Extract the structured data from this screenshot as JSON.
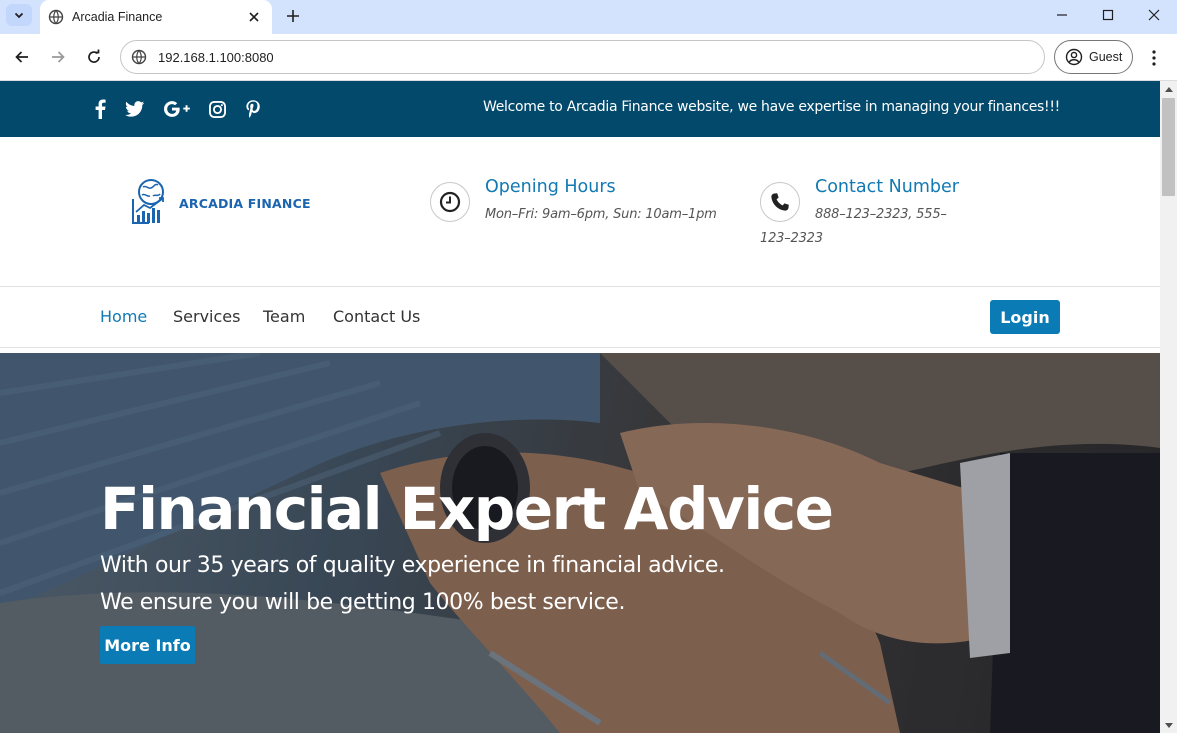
{
  "browser": {
    "tab_title": "Arcadia Finance",
    "url": "192.168.1.100:8080",
    "profile_label": "Guest"
  },
  "topbar": {
    "social_icons": [
      "facebook-icon",
      "twitter-icon",
      "google-plus-icon",
      "instagram-icon",
      "pinterest-icon"
    ],
    "welcome_text": "Welcome to Arcadia Finance website, we have expertise in managing your finances!!!"
  },
  "header": {
    "logo_text": "ARCADIA FINANCE",
    "opening_hours": {
      "title": "Opening Hours",
      "text": "Mon–Fri: 9am–6pm, Sun: 10am–1pm"
    },
    "contact": {
      "title": "Contact Number",
      "line1": "888–123–2323, 555–",
      "line2": "123–2323"
    }
  },
  "nav": {
    "items": [
      {
        "label": "Home",
        "active": true
      },
      {
        "label": "Services",
        "active": false
      },
      {
        "label": "Team",
        "active": false
      },
      {
        "label": "Contact Us",
        "active": false
      }
    ],
    "login_label": "Login"
  },
  "hero": {
    "title": "Financial Expert Advice",
    "subtitle_line1": "With our 35 years of quality experience in financial advice.",
    "subtitle_line2": "We ensure you will be getting 100% best service.",
    "button_label": "More Info"
  },
  "colors": {
    "topbar": "#02496b",
    "accent": "#0b7bb5",
    "link_active": "#1279b3"
  }
}
